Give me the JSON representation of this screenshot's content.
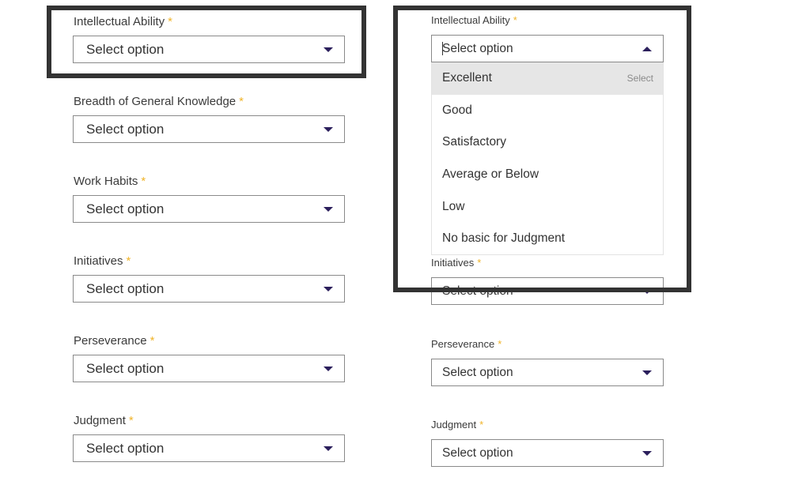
{
  "placeholder": "Select option",
  "left": {
    "fields": [
      {
        "label": "Intellectual Ability",
        "required": "*",
        "value": "Select option"
      },
      {
        "label": "Breadth of General Knowledge",
        "required": "*",
        "value": "Select option"
      },
      {
        "label": "Work Habits",
        "required": "*",
        "value": "Select option"
      },
      {
        "label": "Initiatives",
        "required": "*",
        "value": "Select option"
      },
      {
        "label": "Perseverance",
        "required": "*",
        "value": "Select option"
      },
      {
        "label": "Judgment",
        "required": "*",
        "value": "Select option"
      }
    ]
  },
  "right": {
    "open_field": {
      "label": "Intellectual Ability",
      "required": "*",
      "value": "Select option"
    },
    "options": [
      {
        "label": "Excellent",
        "hint": "Select"
      },
      {
        "label": "Good"
      },
      {
        "label": "Satisfactory"
      },
      {
        "label": "Average or Below"
      },
      {
        "label": "Low"
      },
      {
        "label": "No basic for Judgment"
      }
    ],
    "fields": [
      {
        "label": "Initiatives",
        "required": "*",
        "value": "Select option"
      },
      {
        "label": "Perseverance",
        "required": "*",
        "value": "Select option"
      },
      {
        "label": "Judgment",
        "required": "*",
        "value": "Select option"
      }
    ]
  },
  "colors": {
    "required": "#f0b429",
    "caret": "#2b1f5c",
    "highlight_frame": "#333333",
    "active_option_bg": "#e6e6e6"
  },
  "icons": {
    "closed": "caret-down-icon",
    "open": "caret-up-icon"
  }
}
